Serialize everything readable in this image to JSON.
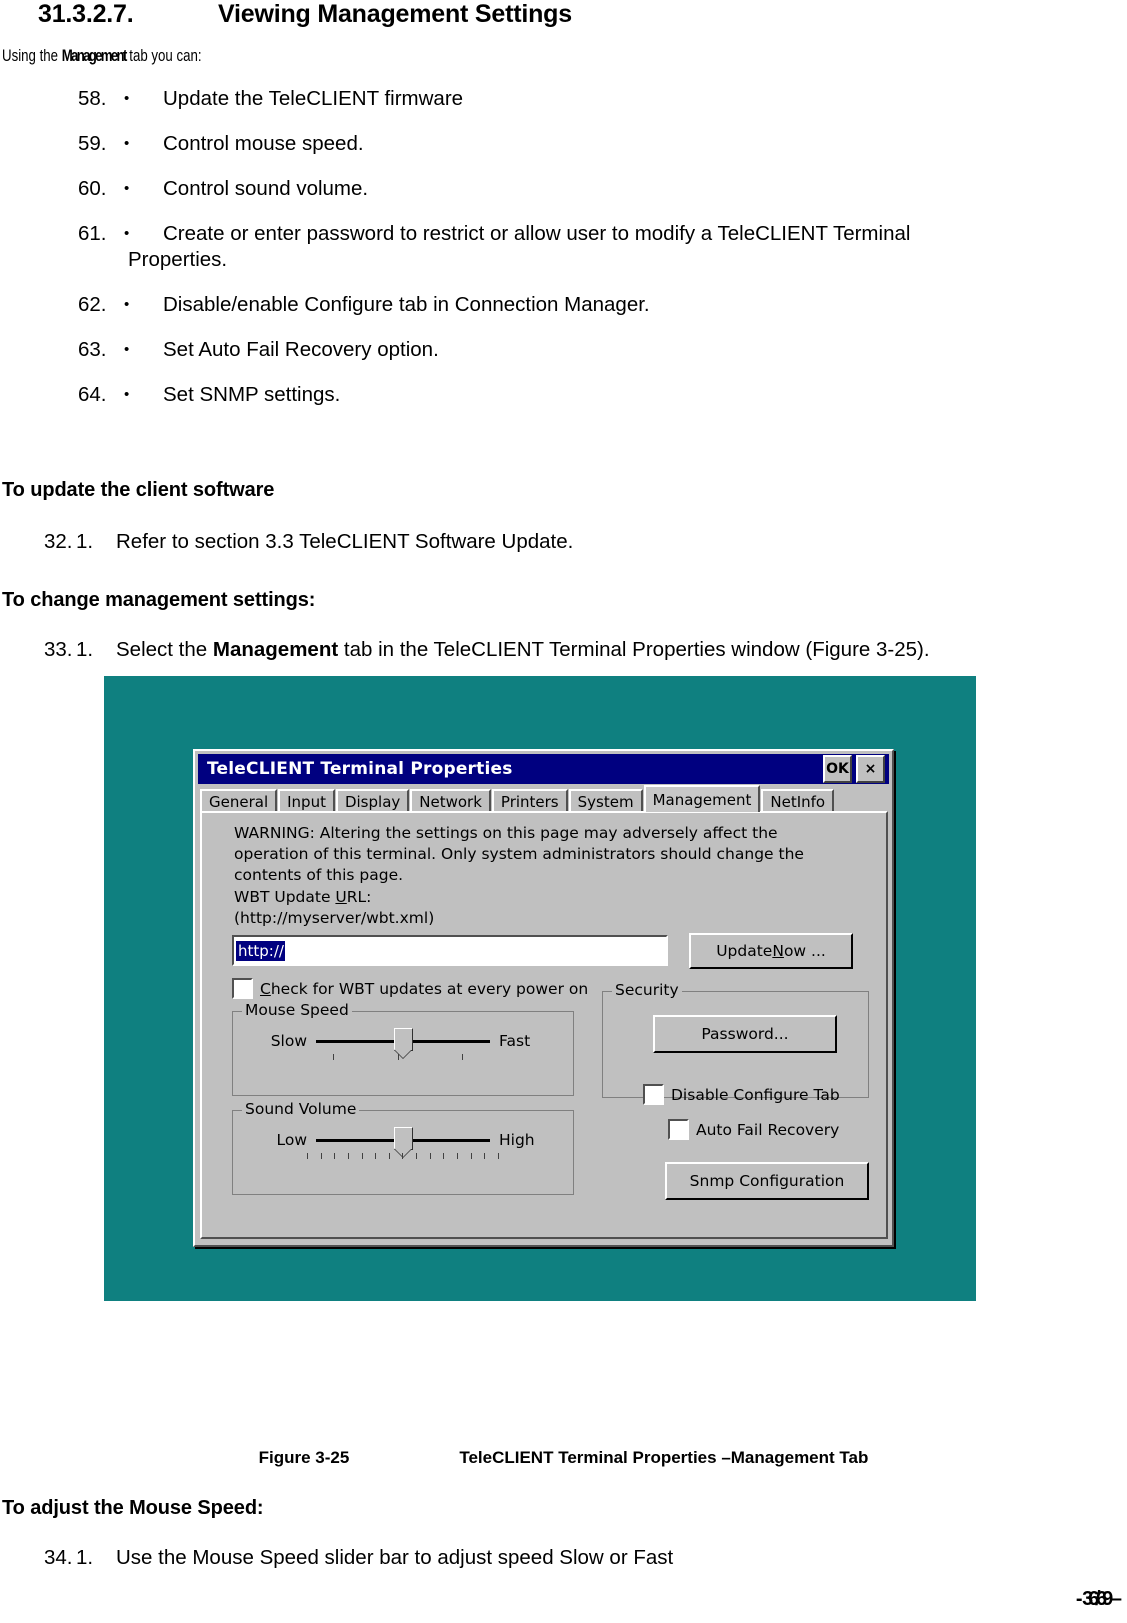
{
  "heading": {
    "number": "31.3.2.7.",
    "title": "Viewing Management Settings"
  },
  "intro": {
    "before": "Using the ",
    "bold": "Management",
    "after": " tab you can:"
  },
  "bullets": [
    {
      "num": "58.",
      "bullet": "•",
      "text": "Update the TeleCLIENT firmware"
    },
    {
      "num": "59.",
      "bullet": "•",
      "text": "Control mouse speed."
    },
    {
      "num": "60.",
      "bullet": "•",
      "text": "Control sound volume."
    },
    {
      "num": "61.",
      "bullet": "•",
      "text": "Create or enter password to restrict or allow user to modify a TeleCLIENT Terminal",
      "cont": "Properties."
    },
    {
      "num": "62.",
      "bullet": "•",
      "text": "Disable/enable Configure tab in Connection Manager."
    },
    {
      "num": "63.",
      "bullet": "•",
      "text": "Set Auto Fail Recovery option."
    },
    {
      "num": "64.",
      "bullet": "•",
      "text": "Set SNMP settings."
    }
  ],
  "sections": {
    "update_heading": "To update the client software",
    "update_step_num": "32.",
    "update_step_sub": "1.",
    "update_step_text": "Refer to section 3.3 TeleCLIENT Software Update.",
    "change_heading": "To change management settings:",
    "change_step_num": "33.",
    "change_step_sub": "1.",
    "change_step_pre": "Select the ",
    "change_step_bold": "Management",
    "change_step_post": " tab in the TeleCLIENT Terminal Properties window (Figure 3-25).",
    "mouse_heading": "To adjust the Mouse Speed:",
    "mouse_step_num": "34.",
    "mouse_step_sub": "1.",
    "mouse_step_text": "Use the Mouse Speed slider bar to adjust speed Slow or Fast"
  },
  "figure": {
    "label": "Figure 3-25",
    "caption": "TeleCLIENT Terminal Properties –Management Tab"
  },
  "footer": {
    "prefix": "-",
    "page": "36 / 69",
    "suffix": "–"
  },
  "dialog": {
    "title": "TeleCLIENT Terminal Properties",
    "ok_label": "OK",
    "close_label": "×",
    "tabs": [
      {
        "label": "General",
        "selected": false
      },
      {
        "label": "Input",
        "selected": false
      },
      {
        "label": "Display",
        "selected": false
      },
      {
        "label": "Network",
        "selected": false
      },
      {
        "label": "Printers",
        "selected": false
      },
      {
        "label": "System",
        "selected": false
      },
      {
        "label": "Management",
        "selected": true
      },
      {
        "label": "NetInfo",
        "selected": false
      }
    ],
    "warning": "WARNING: Altering the settings on this page may adversely affect the operation of this terminal.  Only system administrators should change the contents of this page.",
    "url_label_pre": "WBT Update ",
    "url_label_u": "U",
    "url_label_post": "RL:",
    "url_example": "(http://myserver/wbt.xml)",
    "url_value": "http://",
    "update_now_pre": "Update ",
    "update_now_u": "N",
    "update_now_post": "ow ...",
    "check_updates_pre": "",
    "check_updates_u": "C",
    "check_updates_post": "heck for WBT updates at every power on",
    "mouse_group": "Mouse Speed",
    "mouse_low": "Slow",
    "mouse_high": "Fast",
    "sound_group": "Sound Volume",
    "sound_low": "Low",
    "sound_high": "High",
    "security_group": "Security",
    "password_button": "Password...",
    "disable_configure": "Disable Configure Tab",
    "auto_fail_recovery": "Auto Fail Recovery",
    "snmp_button": "Snmp Configuration"
  },
  "colors": {
    "figure_background": "#0f8080",
    "titlebar": "#000080",
    "dialog_face": "#c0c0c0",
    "selection": "#000080"
  }
}
